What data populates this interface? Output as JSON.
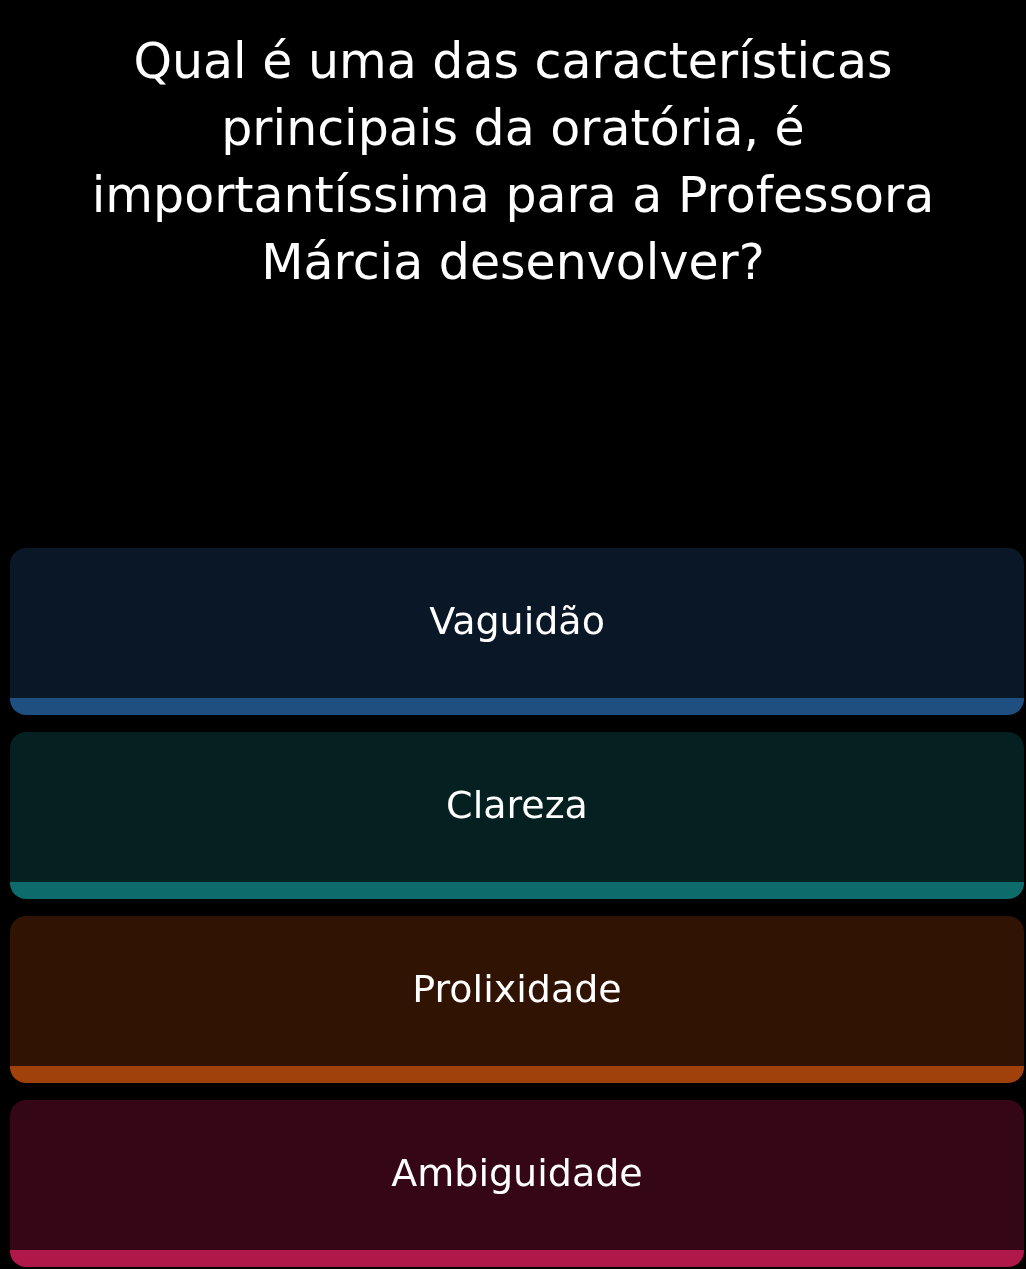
{
  "question": "Qual é uma das características principais da oratória, é importantíssima para a Professora Márcia desenvolver?",
  "answers": [
    {
      "label": "Vaguidão",
      "color": "#1f4e80"
    },
    {
      "label": "Clareza",
      "color": "#0e6b6b"
    },
    {
      "label": "Prolixidade",
      "color": "#a0400a"
    },
    {
      "label": "Ambiguidade",
      "color": "#b0184a"
    }
  ]
}
